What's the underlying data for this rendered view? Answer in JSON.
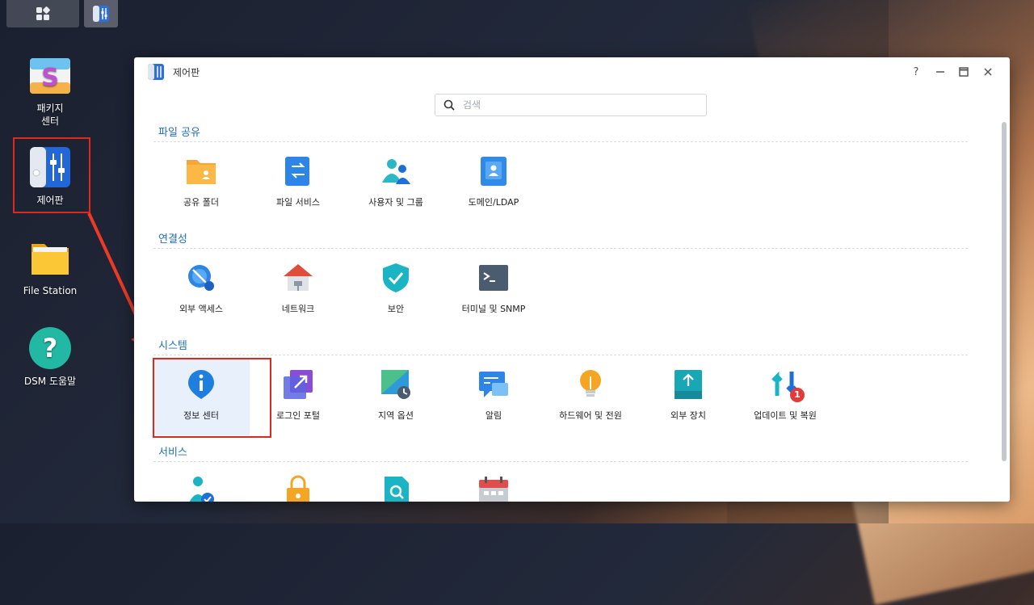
{
  "desktop": {
    "icons": [
      {
        "label_line1": "패키지",
        "label_line2": "센터"
      },
      {
        "label_line1": "제어판",
        "label_line2": ""
      },
      {
        "label_line1": "File Station",
        "label_line2": ""
      },
      {
        "label_line1": "DSM 도움말",
        "label_line2": ""
      }
    ]
  },
  "window": {
    "title": "제어판",
    "help_label": "?",
    "search_placeholder": "검색"
  },
  "sections": [
    {
      "title": "파일 공유",
      "items": [
        "공유 폴더",
        "파일 서비스",
        "사용자 및 그룹",
        "도메인/LDAP"
      ]
    },
    {
      "title": "연결성",
      "items": [
        "외부 액세스",
        "네트워크",
        "보안",
        "터미널 및 SNMP"
      ]
    },
    {
      "title": "시스템",
      "items": [
        "정보 센터",
        "로그인 포털",
        "지역 옵션",
        "알림",
        "하드웨어 및 전원",
        "외부 장치",
        "업데이트 및 복원"
      ]
    },
    {
      "title": "서비스",
      "items": []
    }
  ],
  "update_badge": "1",
  "colors": {
    "accent": "#1f6fc5",
    "highlight": "#e0291c"
  }
}
